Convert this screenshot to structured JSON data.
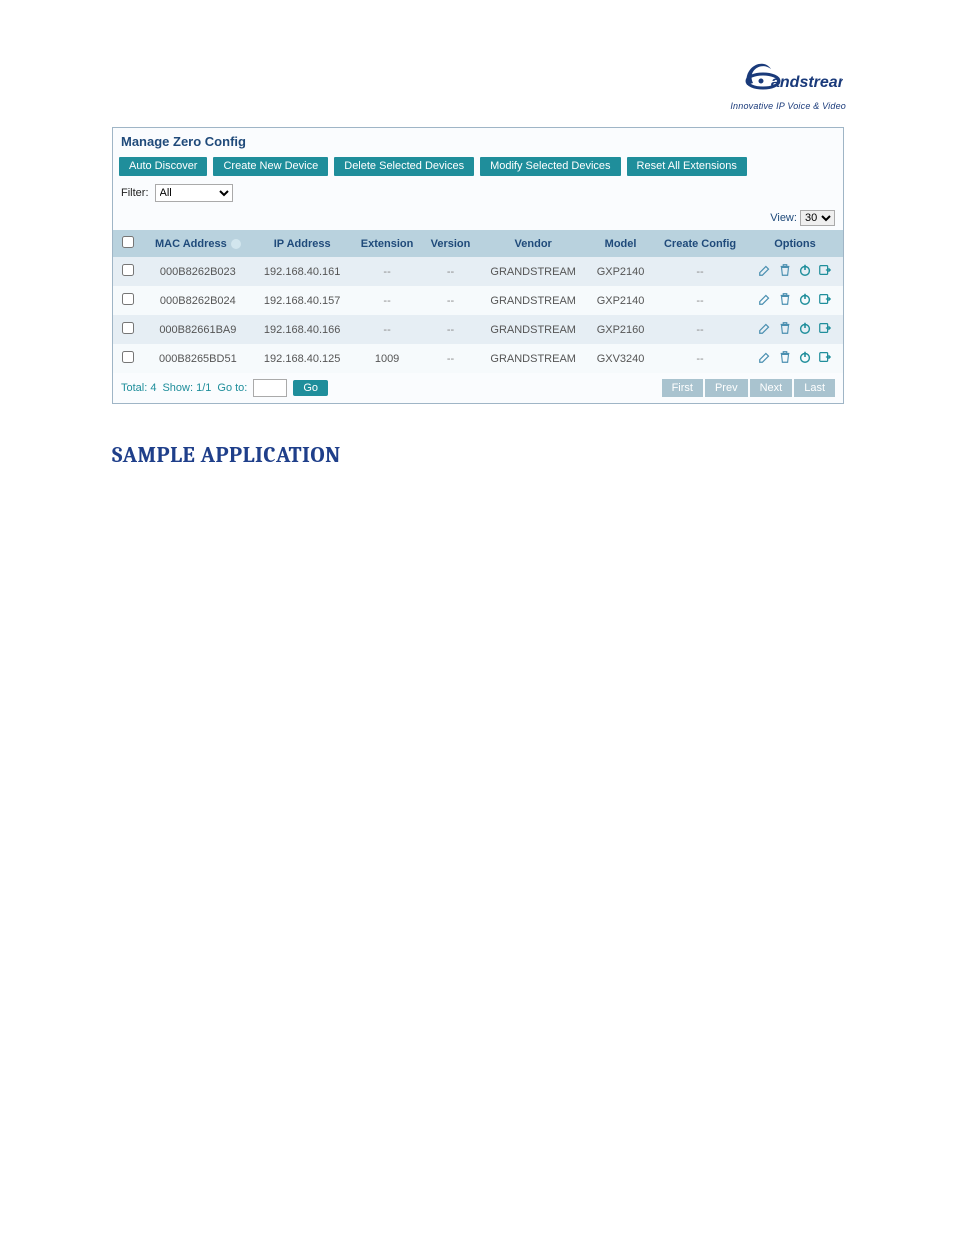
{
  "logo": {
    "brand": "Grandstream",
    "tag": "Innovative IP Voice & Video"
  },
  "panel": {
    "title": "Manage Zero Config"
  },
  "toolbar": {
    "auto_discover": "Auto Discover",
    "create_new": "Create New Device",
    "delete_sel": "Delete Selected Devices",
    "modify_sel": "Modify Selected Devices",
    "reset_all": "Reset All Extensions"
  },
  "filter": {
    "label": "Filter:",
    "value": "All"
  },
  "view": {
    "label": "View:",
    "value": "30"
  },
  "headers": {
    "mac": "MAC Address",
    "ip": "IP Address",
    "ext": "Extension",
    "ver": "Version",
    "vendor": "Vendor",
    "model": "Model",
    "create": "Create Config",
    "options": "Options"
  },
  "rows": [
    {
      "mac": "000B8262B023",
      "ip": "192.168.40.161",
      "ext": "--",
      "ver": "--",
      "vendor": "GRANDSTREAM",
      "model": "GXP2140",
      "create": "--"
    },
    {
      "mac": "000B8262B024",
      "ip": "192.168.40.157",
      "ext": "--",
      "ver": "--",
      "vendor": "GRANDSTREAM",
      "model": "GXP2140",
      "create": "--"
    },
    {
      "mac": "000B82661BA9",
      "ip": "192.168.40.166",
      "ext": "--",
      "ver": "--",
      "vendor": "GRANDSTREAM",
      "model": "GXP2160",
      "create": "--"
    },
    {
      "mac": "000B8265BD51",
      "ip": "192.168.40.125",
      "ext": "1009",
      "ver": "--",
      "vendor": "GRANDSTREAM",
      "model": "GXV3240",
      "create": "--"
    }
  ],
  "footer": {
    "total_label": "Total: 4",
    "show_label": "Show: 1/1",
    "goto_label": "Go to:",
    "go": "Go",
    "first": "First",
    "prev": "Prev",
    "next": "Next",
    "last": "Last"
  },
  "section": {
    "heading": "SAMPLE APPLICATION"
  }
}
